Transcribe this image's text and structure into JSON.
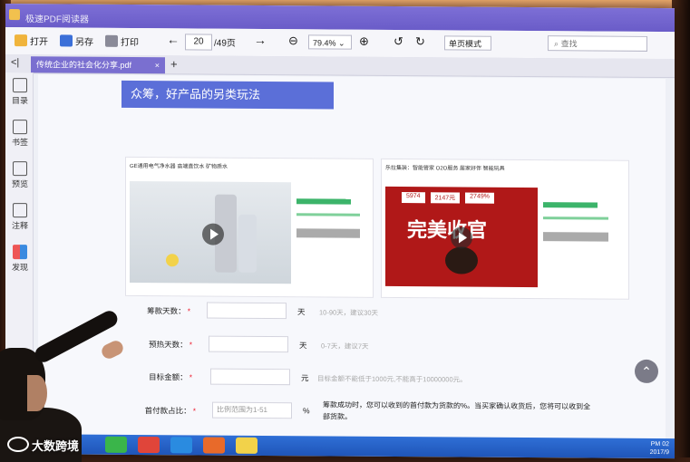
{
  "window": {
    "title": "极速PDF阅读器"
  },
  "toolbar": {
    "open": "打开",
    "save": "另存",
    "print": "打印",
    "page_current": "20",
    "page_total": "/49页",
    "zoom": "79.4%",
    "view_mode": "单页模式",
    "search_placeholder": "查找"
  },
  "tab": {
    "name": "传统企业的社会化分享.pdf",
    "close": "×",
    "add": "+"
  },
  "sidebar": [
    "目录",
    "书签",
    "预览",
    "注释",
    "发现"
  ],
  "slide": {
    "banner": "众筹，好产品的另类玩法",
    "left_shot_title": "GE通用电气净水器 高端直饮水 矿物质水",
    "right_shot_title": "乐拉集装：智能管家 O2O服务 居家好伴 智能玩具",
    "right_shot_overlay": "完美收官",
    "right_shot_stats": [
      "5974",
      "2147元",
      "2749%"
    ],
    "form": {
      "days_label": "筹款天数：",
      "days_unit": "天",
      "days_hint": "10-90天，建议30天",
      "warmup_label": "预热天数：",
      "warmup_unit": "天",
      "warmup_hint": "0-7天，建议7天",
      "target_label": "目标金额：",
      "target_unit": "元",
      "target_hint": "目标金额不能低于1000元,不能高于10000000元。",
      "ratio_label": "首付款占比：",
      "ratio_placeholder": "比例范围为1-51",
      "ratio_unit": "%",
      "ratio_note": "筹款成功时，您可以收到的首付款为货款的%。当买家确认收货后，您将可以收到全部货款。"
    }
  },
  "taskbar": {
    "time": "PM 02",
    "date": "2017/9"
  },
  "watermark": "大数跨境"
}
